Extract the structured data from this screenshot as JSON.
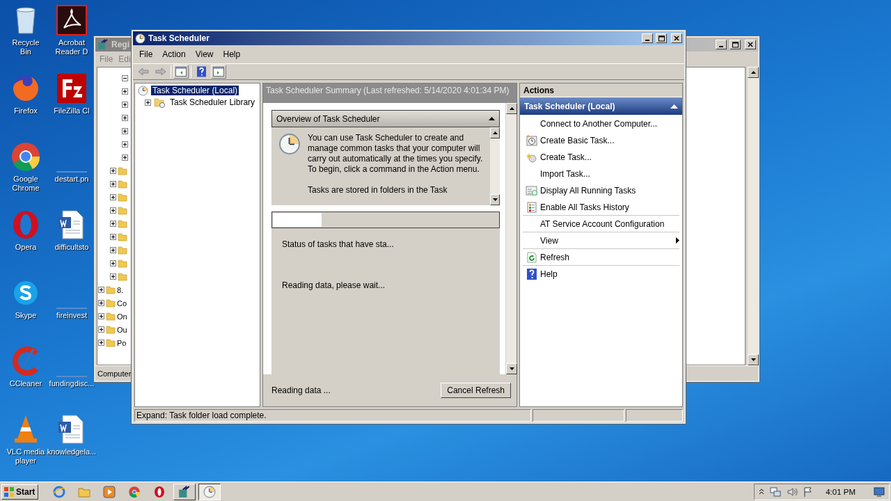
{
  "desktop_icons": [
    {
      "label": "Recycle Bin",
      "kind": "recycle"
    },
    {
      "label": "Acrobat Reader D",
      "kind": "acrobat"
    },
    {
      "label": "Firefox",
      "kind": "firefox"
    },
    {
      "label": "FileZilla Cl",
      "kind": "filezilla"
    },
    {
      "label": "Google Chrome",
      "kind": "chrome"
    },
    {
      "label": "destart.pn",
      "kind": "blank"
    },
    {
      "label": "Opera",
      "kind": "opera"
    },
    {
      "label": "difficultsto",
      "kind": "word"
    },
    {
      "label": "Skype",
      "kind": "skype"
    },
    {
      "label": "fireinvest",
      "kind": "blank"
    },
    {
      "label": "CCleaner",
      "kind": "ccleaner"
    },
    {
      "label": "fundingdisc...",
      "kind": "blank"
    },
    {
      "label": "VLC media player",
      "kind": "vlc"
    },
    {
      "label": "knowledgela...",
      "kind": "word"
    }
  ],
  "registry_window": {
    "title": "Regi",
    "menu": [
      "File",
      "Edi"
    ],
    "tree": [
      {
        "children": [
          {
            "children": [
              {
                "expanded": true
              },
              {
                "expanded": false
              },
              {
                "expanded": false
              },
              {
                "expanded": false
              },
              {
                "expanded": false
              },
              {
                "expanded": false
              },
              {
                "expanded": false
              }
            ]
          },
          {
            "expanded": false
          },
          {
            "expanded": false
          },
          {
            "expanded": false
          },
          {
            "expanded": false
          },
          {
            "expanded": false
          },
          {
            "expanded": false
          },
          {
            "expanded": false
          },
          {
            "expanded": false
          },
          {
            "expanded": false
          }
        ]
      },
      {
        "label": "8.",
        "expanded": false
      },
      {
        "label": "Co",
        "expanded": false
      },
      {
        "label": "On",
        "expanded": false
      },
      {
        "label": "Ou",
        "expanded": false
      },
      {
        "label": "Po",
        "expanded": false
      }
    ],
    "status": "Computer"
  },
  "task_scheduler": {
    "title": "Task Scheduler",
    "menu": [
      "File",
      "Action",
      "View",
      "Help"
    ],
    "tree": [
      {
        "label": "Task Scheduler (Local)",
        "selected": true,
        "children": [
          {
            "label": "Task Scheduler Library",
            "selected": false,
            "expanded": false
          }
        ]
      }
    ],
    "summary": {
      "header": "Task Scheduler Summary (Last refreshed: 5/14/2020 4:01:34 PM)",
      "overview_title": "Overview of Task Scheduler",
      "overview_text": "You can use Task Scheduler to create and manage common tasks that your computer will carry out automatically at the times you specify. To begin, click a command in the Action menu.",
      "overview_more": "Tasks are stored in folders in the Task",
      "status_text": "Status of tasks that have sta...",
      "loading": "Reading data, please wait...",
      "footer": "Reading data ...",
      "button": "Cancel Refresh"
    },
    "actions": {
      "title": "Actions",
      "section": "Task Scheduler (Local)",
      "items": [
        {
          "label": "Connect to Another Computer...",
          "kind": "plain",
          "separator_before": false
        },
        {
          "label": "Create Basic Task...",
          "kind": "basic",
          "separator_before": false
        },
        {
          "label": "Create Task...",
          "kind": "create",
          "separator_before": false
        },
        {
          "label": "Import Task...",
          "kind": "plain",
          "separator_before": false
        },
        {
          "label": "Display All Running Tasks",
          "kind": "running",
          "separator_before": false
        },
        {
          "label": "Enable All Tasks History",
          "kind": "history",
          "separator_before": false
        },
        {
          "label": "AT Service Account Configuration",
          "kind": "plain",
          "separator_before": true
        },
        {
          "label": "View",
          "kind": "submenu",
          "separator_before": true
        },
        {
          "label": "Refresh",
          "kind": "refresh",
          "separator_before": true
        },
        {
          "label": "Help",
          "kind": "help",
          "separator_before": true
        }
      ]
    },
    "status_bar": "Expand:  Task folder load complete."
  },
  "taskbar": {
    "start": "Start",
    "apps": [
      {
        "kind": "ie",
        "active": false
      },
      {
        "kind": "explorer",
        "active": false
      },
      {
        "kind": "media",
        "active": false
      },
      {
        "kind": "chrome",
        "active": false
      },
      {
        "kind": "opera",
        "active": false
      },
      {
        "kind": "regedit",
        "active": false
      },
      {
        "kind": "clock",
        "active": true
      }
    ],
    "time": "4:01 PM"
  }
}
